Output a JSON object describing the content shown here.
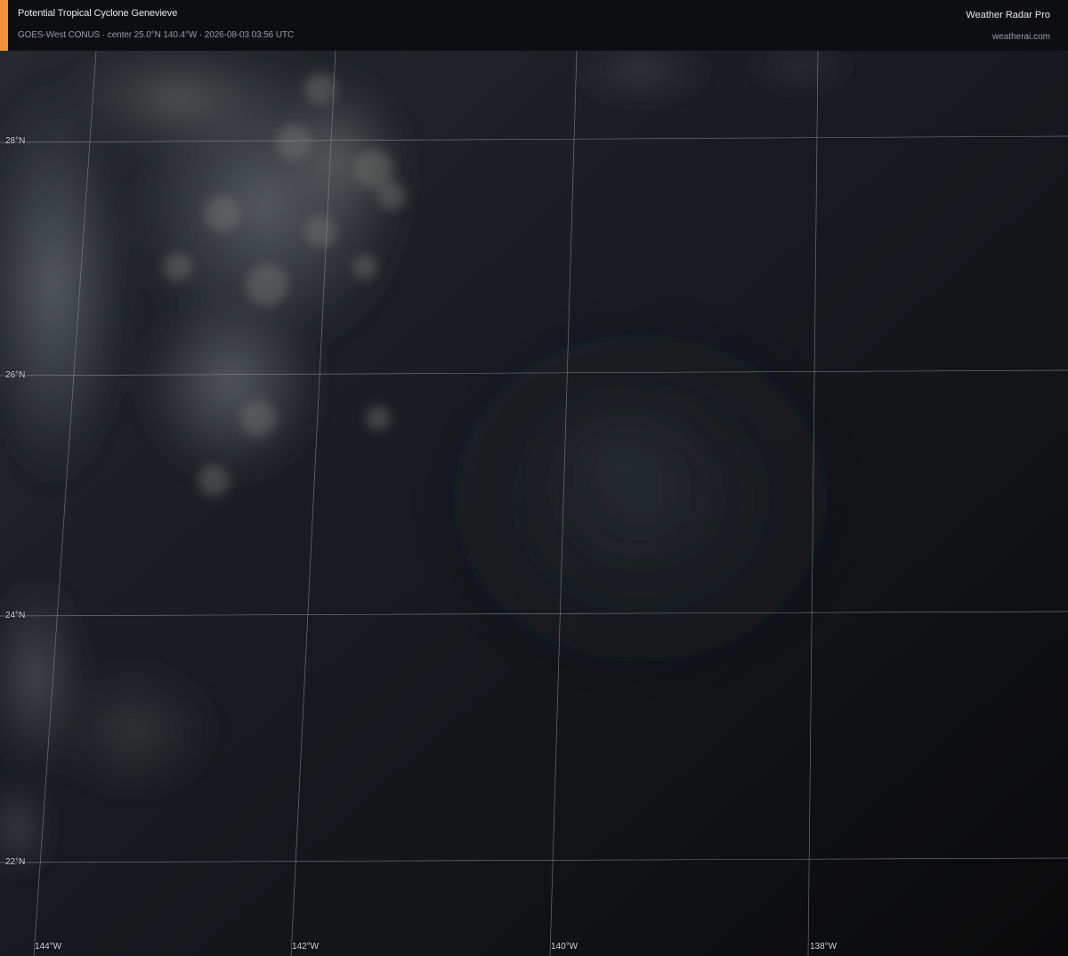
{
  "header": {
    "title": "Potential Tropical Cyclone Genevieve",
    "subtitle": "GOES-West CONUS · center 25.0°N 140.4°W · 2026-08-03 03:56 UTC",
    "brand": "Weather Radar Pro",
    "site": "weatherai.com",
    "accent_color": "#f0913a"
  },
  "map": {
    "latitude_labels": [
      "28°N",
      "26°N",
      "24°N",
      "22°N"
    ],
    "longitude_labels": [
      "144°W",
      "142°W",
      "140°W",
      "138°W"
    ],
    "gridline_color": "#8a8d93",
    "background_color": "#15181c"
  }
}
